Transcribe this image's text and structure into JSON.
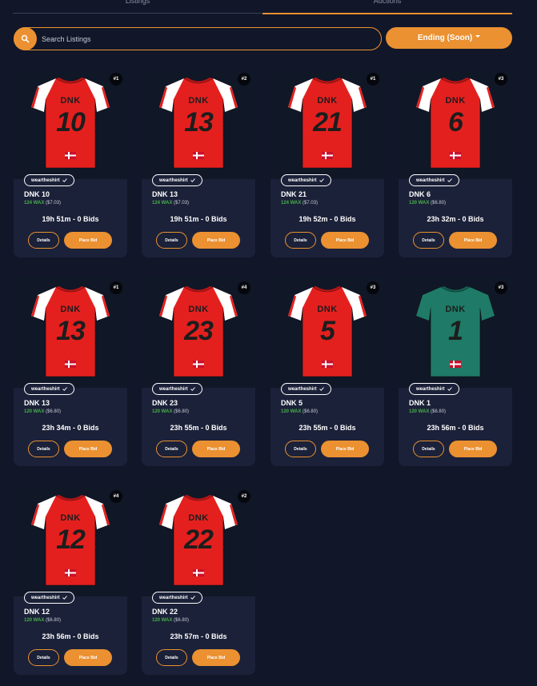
{
  "tabs": [
    {
      "label": "Listings",
      "active": false
    },
    {
      "label": "Auctions",
      "active": true
    }
  ],
  "search": {
    "placeholder": "Search Listings",
    "value": ""
  },
  "sort": {
    "label": "Ending (Soon)"
  },
  "colors": {
    "accent": "#eb9131",
    "background": "#111729",
    "card": "#1b2138",
    "wax_green": "#47b04b"
  },
  "card_labels": {
    "details": "Details",
    "bid": "Place Bid"
  },
  "listings": [
    {
      "name_on_shirt": "DNK",
      "number": "10",
      "rank": "#1",
      "seller": "weartheshirt",
      "title": "DNK 10",
      "price_wax": "124 WAX",
      "price_usd": "($7.03)",
      "time": "19h 51m",
      "bids": "0 Bids",
      "kit": "red"
    },
    {
      "name_on_shirt": "DNK",
      "number": "13",
      "rank": "#2",
      "seller": "weartheshirt",
      "title": "DNK 13",
      "price_wax": "124 WAX",
      "price_usd": "($7.03)",
      "time": "19h 51m",
      "bids": "0 Bids",
      "kit": "red"
    },
    {
      "name_on_shirt": "DNK",
      "number": "21",
      "rank": "#1",
      "seller": "weartheshirt",
      "title": "DNK 21",
      "price_wax": "124 WAX",
      "price_usd": "($7.03)",
      "time": "19h 52m",
      "bids": "0 Bids",
      "kit": "red"
    },
    {
      "name_on_shirt": "DNK",
      "number": "6",
      "rank": "#3",
      "seller": "weartheshirt",
      "title": "DNK 6",
      "price_wax": "120 WAX",
      "price_usd": "($6.80)",
      "time": "23h 32m",
      "bids": "0 Bids",
      "kit": "red"
    },
    {
      "name_on_shirt": "DNK",
      "number": "13",
      "rank": "#1",
      "seller": "weartheshirt",
      "title": "DNK 13",
      "price_wax": "120 WAX",
      "price_usd": "($6.80)",
      "time": "23h 34m",
      "bids": "0 Bids",
      "kit": "red"
    },
    {
      "name_on_shirt": "DNK",
      "number": "23",
      "rank": "#4",
      "seller": "weartheshirt",
      "title": "DNK 23",
      "price_wax": "120 WAX",
      "price_usd": "($6.80)",
      "time": "23h 55m",
      "bids": "0 Bids",
      "kit": "red"
    },
    {
      "name_on_shirt": "DNK",
      "number": "5",
      "rank": "#3",
      "seller": "weartheshirt",
      "title": "DNK 5",
      "price_wax": "120 WAX",
      "price_usd": "($6.80)",
      "time": "23h 55m",
      "bids": "0 Bids",
      "kit": "red"
    },
    {
      "name_on_shirt": "DNK",
      "number": "1",
      "rank": "#3",
      "seller": "weartheshirt",
      "title": "DNK 1",
      "price_wax": "120 WAX",
      "price_usd": "($6.80)",
      "time": "23h 56m",
      "bids": "0 Bids",
      "kit": "green"
    },
    {
      "name_on_shirt": "DNK",
      "number": "12",
      "rank": "#4",
      "seller": "weartheshirt",
      "title": "DNK 12",
      "price_wax": "120 WAX",
      "price_usd": "($6.80)",
      "time": "23h 56m",
      "bids": "0 Bids",
      "kit": "red"
    },
    {
      "name_on_shirt": "DNK",
      "number": "22",
      "rank": "#2",
      "seller": "weartheshirt",
      "title": "DNK 22",
      "price_wax": "120 WAX",
      "price_usd": "($6.80)",
      "time": "23h 57m",
      "bids": "0 Bids",
      "kit": "red"
    }
  ]
}
